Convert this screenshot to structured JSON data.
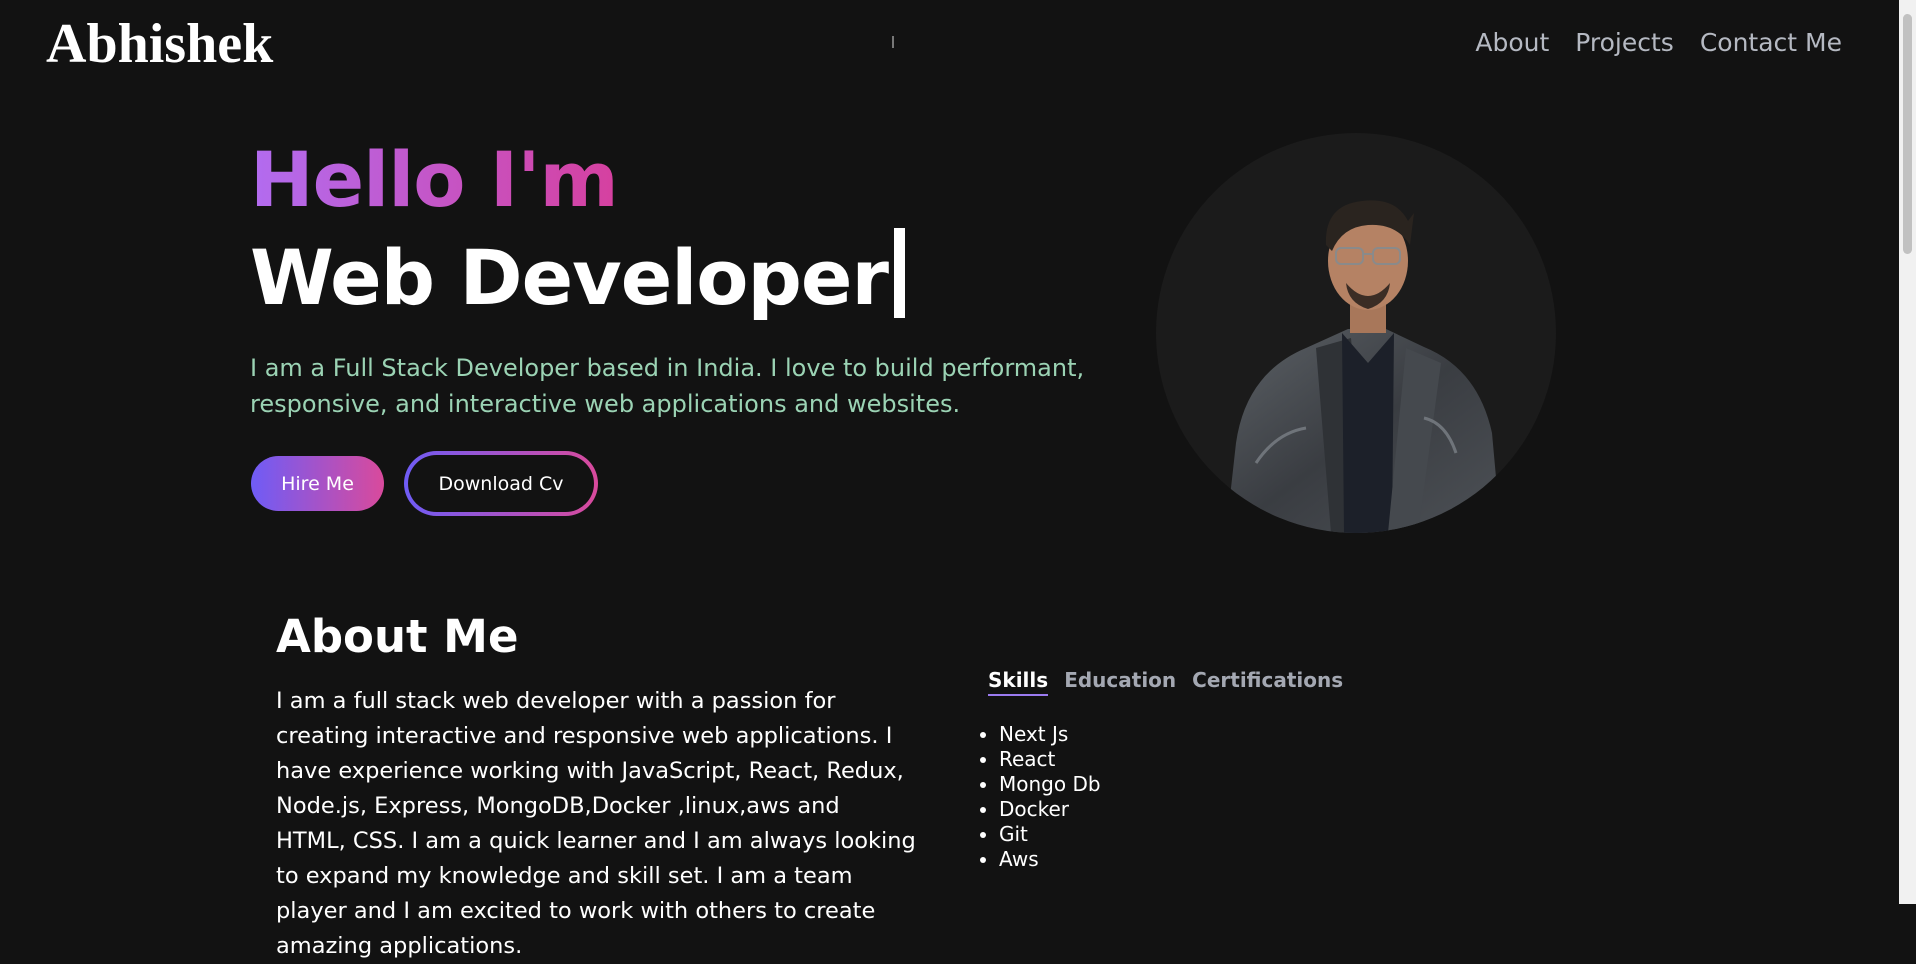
{
  "navbar": {
    "logo": "Abhishek",
    "links": [
      "About",
      "Projects",
      "Contact Me"
    ]
  },
  "hero": {
    "greeting": "Hello I'm",
    "role": "Web Developer",
    "description": "I am a Full Stack Developer based in India. I love to build performant, responsive, and interactive web applications and websites.",
    "hire_label": "Hire Me",
    "download_label": "Download Cv"
  },
  "about": {
    "title": "About Me",
    "text": "I am a full stack web developer with a passion for creating interactive and responsive web applications. I have experience working with JavaScript, React, Redux, Node.js, Express, MongoDB,Docker ,linux,aws and HTML, CSS. I am a quick learner and I am always looking to expand my knowledge and skill set. I am a team player and I am excited to work with others to create amazing applications.",
    "tabs": [
      "Skills",
      "Education",
      "Certifications"
    ],
    "active_tab": "Skills",
    "skills": [
      "Next Js",
      "React",
      "Mongo Db",
      "Docker",
      "Git",
      "Aws"
    ]
  },
  "colors": {
    "background": "#121212",
    "accent_purple": "#6f5cf6",
    "accent_pink": "#d94a9c",
    "description_green": "#9bd3b4"
  }
}
